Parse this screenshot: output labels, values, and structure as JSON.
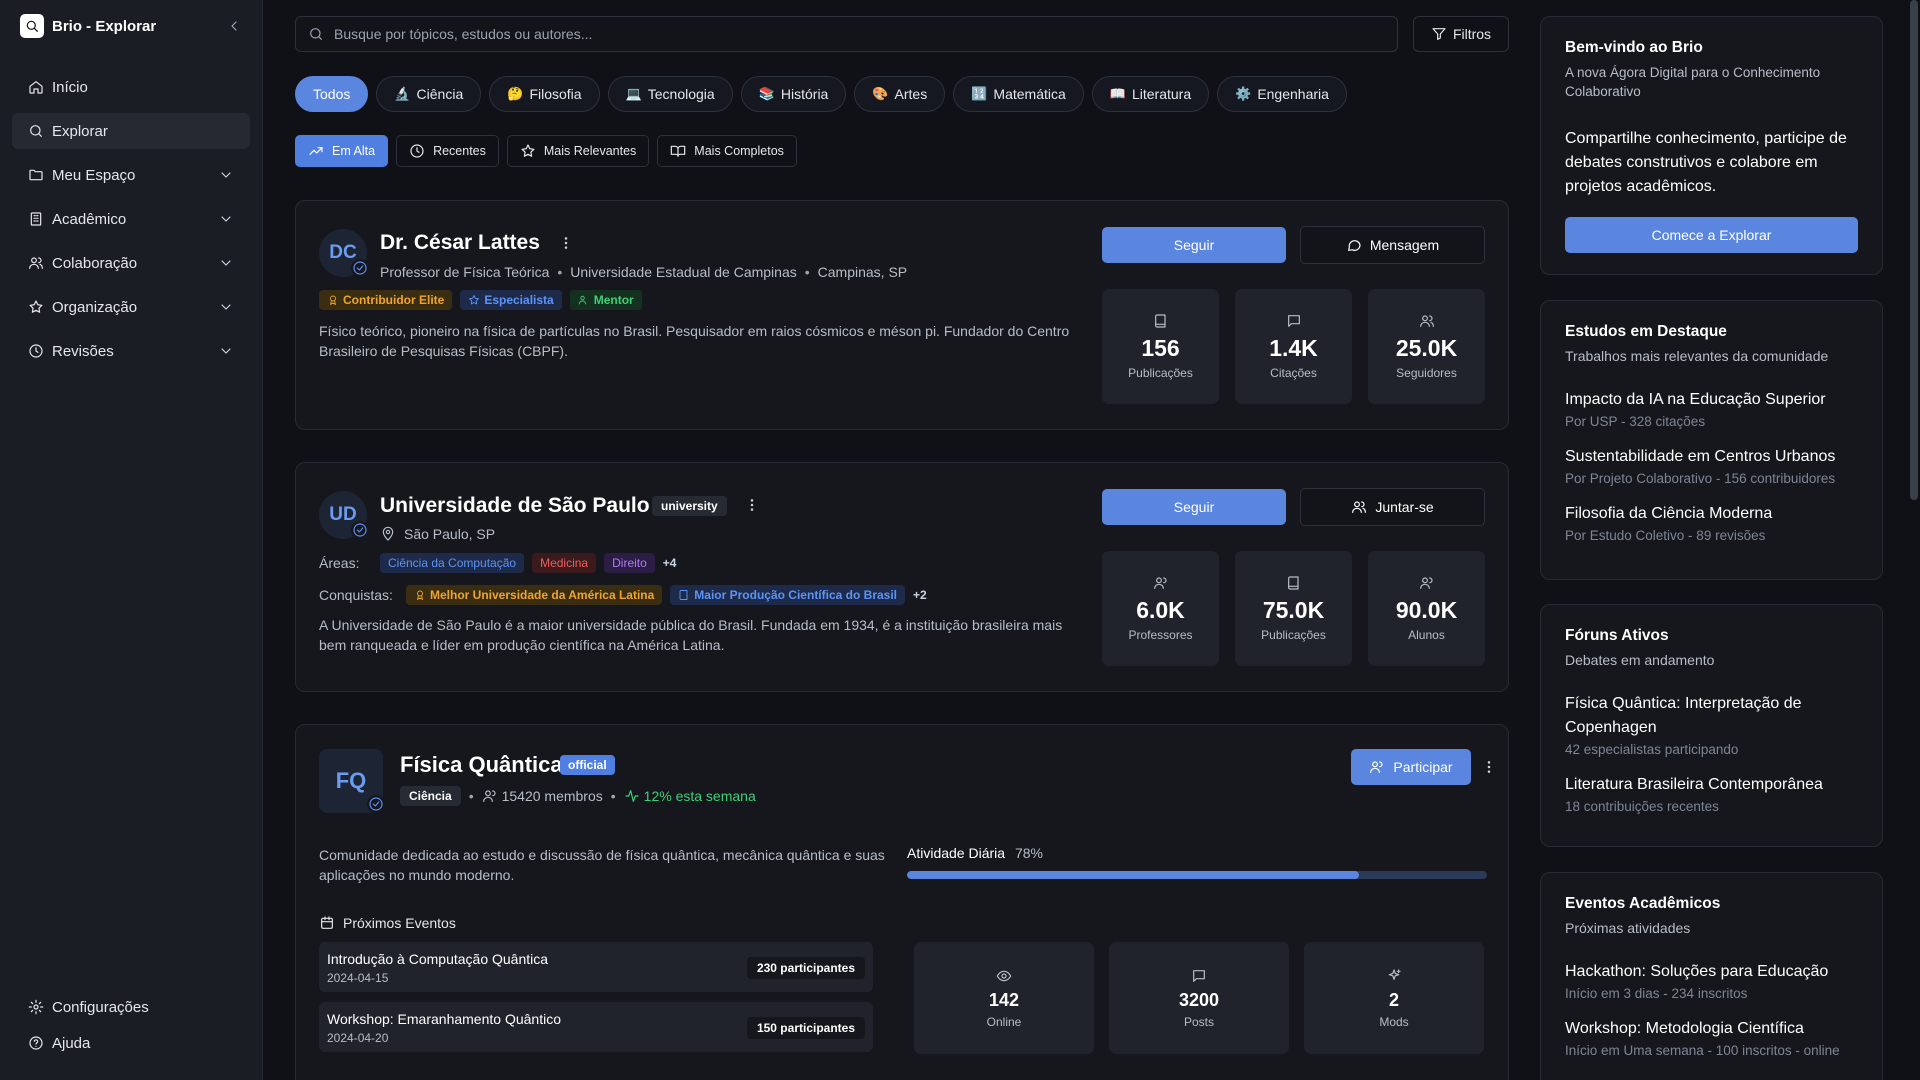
{
  "app": {
    "title": "Brio - Explorar"
  },
  "sidebar": {
    "items": [
      {
        "label": "Início",
        "icon": "home-icon"
      },
      {
        "label": "Explorar",
        "icon": "search-icon"
      },
      {
        "label": "Meu Espaço",
        "icon": "folder-icon"
      },
      {
        "label": "Acadêmico",
        "icon": "building-icon"
      },
      {
        "label": "Colaboração",
        "icon": "users-icon"
      },
      {
        "label": "Organização",
        "icon": "star-icon"
      },
      {
        "label": "Revisões",
        "icon": "clock-icon"
      }
    ],
    "footer": [
      {
        "label": "Configurações",
        "icon": "gear-icon"
      },
      {
        "label": "Ajuda",
        "icon": "help-icon"
      }
    ]
  },
  "search": {
    "placeholder": "Busque por tópicos, estudos ou autores..."
  },
  "filters_label": "Filtros",
  "categories": [
    {
      "label": "Todos",
      "emoji": ""
    },
    {
      "label": "Ciência",
      "emoji": "🔬"
    },
    {
      "label": "Filosofia",
      "emoji": "🤔"
    },
    {
      "label": "Tecnologia",
      "emoji": "💻"
    },
    {
      "label": "História",
      "emoji": "📚"
    },
    {
      "label": "Artes",
      "emoji": "🎨"
    },
    {
      "label": "Matemática",
      "emoji": "🔢"
    },
    {
      "label": "Literatura",
      "emoji": "📖"
    },
    {
      "label": "Engenharia",
      "emoji": "⚙️"
    }
  ],
  "sorts": [
    "Em Alta",
    "Recentes",
    "Mais Relevantes",
    "Mais Completos"
  ],
  "card1": {
    "initials": "DC",
    "name": "Dr. César Lattes",
    "role": "Professor de Física Teórica",
    "institution": "Universidade Estadual de Campinas",
    "location": "Campinas, SP",
    "badges": [
      "Contribuidor Elite",
      "Especialista",
      "Mentor"
    ],
    "description": "Físico teórico, pioneiro na física de partículas no Brasil. Pesquisador em raios cósmicos e méson pi. Fundador do Centro Brasileiro de Pesquisas Físicas (CBPF).",
    "follow": "Seguir",
    "message": "Mensagem",
    "stats": [
      {
        "value": "156",
        "label": "Publicações"
      },
      {
        "value": "1.4K",
        "label": "Citações"
      },
      {
        "value": "25.0K",
        "label": "Seguidores"
      }
    ]
  },
  "card2": {
    "initials": "UD",
    "name": "Universidade de São Paulo",
    "type": "university",
    "location": "São Paulo, SP",
    "areas_label": "Áreas:",
    "areas": [
      "Ciência da Computação",
      "Medicina",
      "Direito"
    ],
    "areas_more": "+4",
    "achievements_label": "Conquistas:",
    "achievements": [
      "Melhor Universidade da América Latina",
      "Maior Produção Científica do Brasil"
    ],
    "achievements_more": "+2",
    "description": "A Universidade de São Paulo é a maior universidade pública do Brasil. Fundada em 1934, é a instituição brasileira mais bem ranqueada e líder em produção científica na América Latina.",
    "follow": "Seguir",
    "join": "Juntar-se",
    "stats": [
      {
        "value": "6.0K",
        "label": "Professores"
      },
      {
        "value": "75.0K",
        "label": "Publicações"
      },
      {
        "value": "90.0K",
        "label": "Alunos"
      }
    ]
  },
  "card3": {
    "initials": "FQ",
    "name": "Física Quântica",
    "official": "official",
    "category": "Ciência",
    "members": "15420 membros",
    "growth": "12% esta semana",
    "participate": "Participar",
    "description": "Comunidade dedicada ao estudo e discussão de física quântica, mecânica quântica e suas aplicações no mundo moderno.",
    "activity_label": "Atividade Diária",
    "activity_text": "78%",
    "activity_value": 0.78,
    "events_title": "Próximos Eventos",
    "events": [
      {
        "title": "Introdução à Computação Quântica",
        "date": "2024-04-15",
        "participants": "230 participantes"
      },
      {
        "title": "Workshop: Emaranhamento Quântico",
        "date": "2024-04-20",
        "participants": "150 participantes"
      }
    ],
    "stats": [
      {
        "value": "142",
        "label": "Online"
      },
      {
        "value": "3200",
        "label": "Posts"
      },
      {
        "value": "2",
        "label": "Mods"
      }
    ]
  },
  "right": {
    "welcome": {
      "title": "Bem-vindo ao Brio",
      "subtitle": "A nova Ágora Digital para o Conhecimento Colaborativo",
      "body": "Compartilhe conhecimento, participe de debates construtivos e colabore em projetos acadêmicos.",
      "cta": "Comece a Explorar"
    },
    "studies": {
      "title": "Estudos em Destaque",
      "subtitle": "Trabalhos mais relevantes da comunidade",
      "items": [
        {
          "title": "Impacto da IA na Educação Superior",
          "meta": "Por USP - 328 citações"
        },
        {
          "title": "Sustentabilidade em Centros Urbanos",
          "meta": "Por Projeto Colaborativo - 156 contribuidores"
        },
        {
          "title": "Filosofia da Ciência Moderna",
          "meta": "Por Estudo Coletivo - 89 revisões"
        }
      ]
    },
    "forums": {
      "title": "Fóruns Ativos",
      "subtitle": "Debates em andamento",
      "items": [
        {
          "title": "Física Quântica: Interpretação de Copenhagen",
          "meta": "42 especialistas participando"
        },
        {
          "title": "Literatura Brasileira Contemporânea",
          "meta": "18 contribuições recentes"
        }
      ]
    },
    "events": {
      "title": "Eventos Acadêmicos",
      "subtitle": "Próximas atividades",
      "items": [
        {
          "title": "Hackathon: Soluções para Educação",
          "meta": "Início em 3 dias - 234 inscritos"
        },
        {
          "title": "Workshop: Metodologia Científica",
          "meta": "Início em Uma semana - 100 inscritos - online"
        }
      ]
    }
  }
}
